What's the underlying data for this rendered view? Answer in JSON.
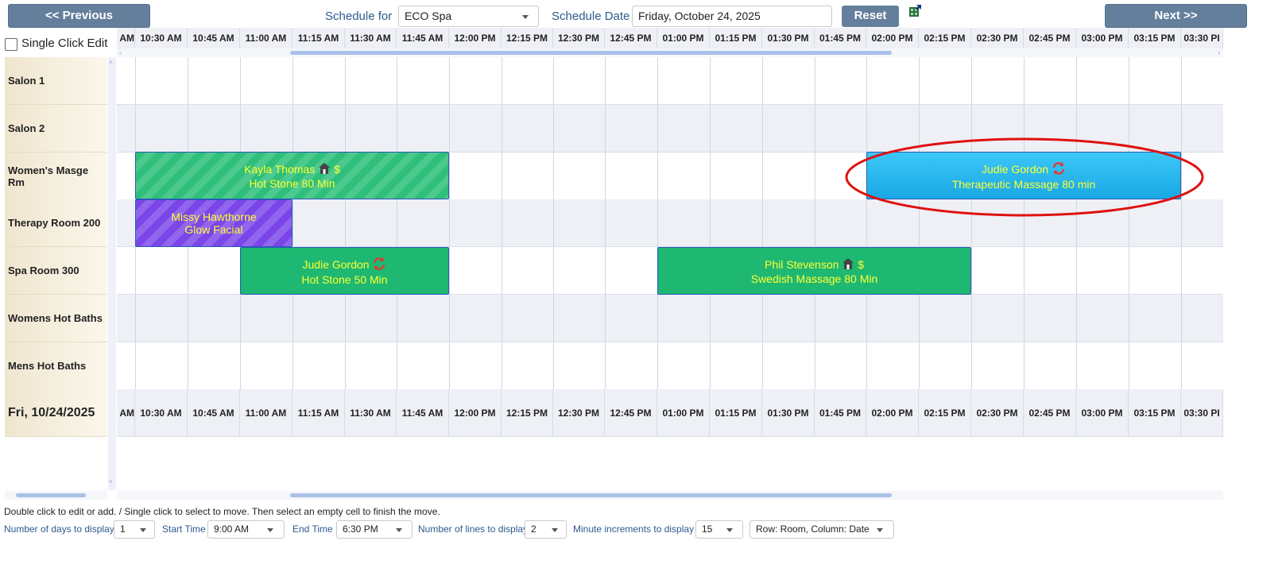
{
  "header": {
    "prev_label": "<< Previous",
    "next_label": "Next >>",
    "schedule_for_label": "Schedule for",
    "schedule_for_value": "ECO Spa",
    "schedule_date_label": "Schedule Date",
    "schedule_date_value": "Friday, October 24, 2025",
    "reset_label": "Reset",
    "single_click_label": "Single Click Edit"
  },
  "times": [
    "AM",
    "10:30 AM",
    "10:45 AM",
    "11:00 AM",
    "11:15 AM",
    "11:30 AM",
    "11:45 AM",
    "12:00 PM",
    "12:15 PM",
    "12:30 PM",
    "12:45 PM",
    "01:00 PM",
    "01:15 PM",
    "01:30 PM",
    "01:45 PM",
    "02:00 PM",
    "02:15 PM",
    "02:30 PM",
    "02:45 PM",
    "03:00 PM",
    "03:15 PM",
    "03:30 PI"
  ],
  "rooms": [
    "Salon 1",
    "Salon 2",
    "Women's Masge Rm",
    "Therapy Room 200",
    "Spa Room 300",
    "Womens Hot Baths",
    "Mens Hot Baths"
  ],
  "date_row_label": "Fri, 10/24/2025",
  "appointments": {
    "kayla": {
      "name": "Kayla Thomas",
      "service": "Hot Stone 80 Min",
      "symbol": "$"
    },
    "missy": {
      "name": "Missy Hawthorne",
      "service": "Glow Facial"
    },
    "judie1": {
      "name": "Judie Gordon",
      "service": "Hot Stone 50 Min"
    },
    "phil": {
      "name": "Phil Stevenson",
      "service": "Swedish Massage 80 Min",
      "symbol": "$"
    },
    "judie2": {
      "name": "Judie Gordon",
      "service": "Therapeutic Massage 80 min"
    }
  },
  "footer": {
    "instructions": "Double click to edit or add. / Single click to select to move. Then select an empty cell to finish the move.",
    "days_label": "Number of days to display",
    "days_value": "1",
    "start_label": "Start Time",
    "start_value": "9:00 AM",
    "end_label": "End Time",
    "end_value": "6:30 PM",
    "lines_label": "Number of lines to display",
    "lines_value": "2",
    "increments_label": "Minute increments to display",
    "increments_value": "15",
    "layout_value": "Row: Room, Column: Date"
  },
  "colors": {
    "nav_button": "#647f9c",
    "appt_green": "#1eb872",
    "appt_purple": "#7b45e8",
    "appt_blue": "#19a8e4",
    "appt_text": "#ffff33",
    "highlight_ring": "#e01010"
  }
}
